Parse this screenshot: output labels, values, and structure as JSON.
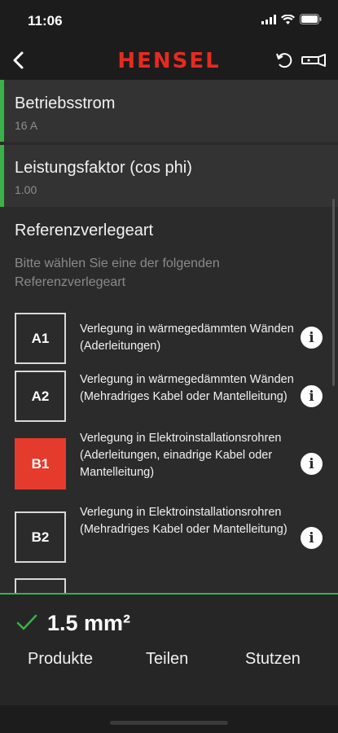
{
  "status": {
    "time": "11:06"
  },
  "header": {
    "logo": "HENSEL"
  },
  "params": [
    {
      "label": "Betriebsstrom",
      "value": "16 A"
    },
    {
      "label": "Leistungsfaktor (cos phi)",
      "value": "1.00"
    }
  ],
  "section": {
    "title": "Referenzverlegeart",
    "hint": "Bitte wählen Sie eine der folgenden Referenzverlegeart"
  },
  "options": [
    {
      "code": "A1",
      "text": "Verlegung in wärmegedämmten Wänden (Aderleitungen)",
      "selected": false
    },
    {
      "code": "A2",
      "text": "Verlegung in wärmegedämmten Wänden (Mehradriges Kabel oder Mantelleitung)",
      "selected": false
    },
    {
      "code": "B1",
      "text": "Verlegung in Elektroinstallationsrohren (Aderleitungen, einadrige Kabel oder Mantelleitung)",
      "selected": true
    },
    {
      "code": "B2",
      "text": "Verlegung in Elektroinstallationsrohren (Mehradriges Kabel oder Mantelleitung)",
      "selected": false
    }
  ],
  "result": {
    "value": "1.5 mm²"
  },
  "actions": {
    "products": "Produkte",
    "share": "Teilen",
    "support": "Stutzen"
  },
  "colors": {
    "accent_green": "#3bb14a",
    "brand_red": "#e52b21",
    "selected_red": "#e53b2c"
  }
}
